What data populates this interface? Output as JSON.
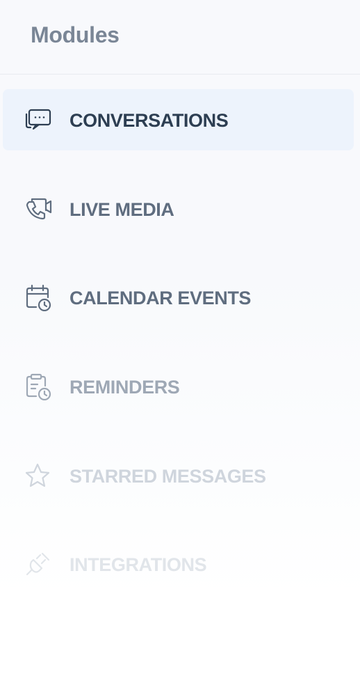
{
  "header": {
    "title": "Modules"
  },
  "nav": {
    "items": [
      {
        "label": "CONVERSATIONS",
        "icon": "chat-bubbles-icon",
        "active": true
      },
      {
        "label": "LIVE MEDIA",
        "icon": "video-call-icon",
        "active": false
      },
      {
        "label": "CALENDAR EVENTS",
        "icon": "calendar-clock-icon",
        "active": false
      },
      {
        "label": "REMINDERS",
        "icon": "clipboard-clock-icon",
        "active": false
      },
      {
        "label": "STARRED MESSAGES",
        "icon": "star-icon",
        "active": false
      },
      {
        "label": "INTEGRATIONS",
        "icon": "plug-icon",
        "active": false
      }
    ]
  },
  "colors": {
    "active_background": "#edf3fc",
    "label_tones": [
      "#2d3e52",
      "#5f6d7f",
      "#5f6d7f",
      "#9ea8b5",
      "#cfd5dd",
      "#e1e5ea"
    ]
  }
}
